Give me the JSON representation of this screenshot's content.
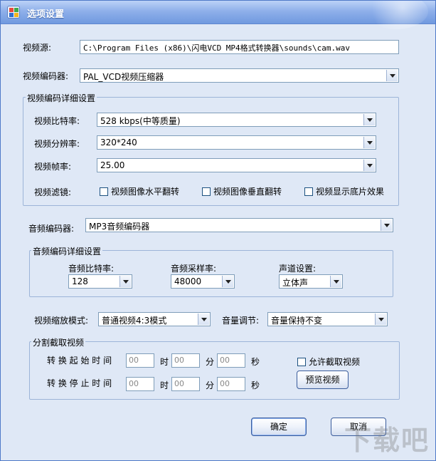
{
  "window": {
    "title": "选项设置"
  },
  "source": {
    "label": "视频源:",
    "value": "C:\\Program Files (x86)\\闪电VCD MP4格式转换器\\sounds\\cam.wav"
  },
  "video_encoder": {
    "label": "视频编码器:",
    "value": "PAL_VCD视频压缩器"
  },
  "video_detail": {
    "title": "视频编码详细设置",
    "bitrate": {
      "label": "视频比特率:",
      "value": "528 kbps(中等质量)"
    },
    "resolution": {
      "label": "视频分辨率:",
      "value": "320*240"
    },
    "framerate": {
      "label": "视频帧率:",
      "value": "25.00"
    },
    "filter": {
      "label": "视频滤镜:",
      "options": [
        "视频图像水平翻转",
        "视频图像垂直翻转",
        "视频显示底片效果"
      ]
    }
  },
  "audio_encoder": {
    "label": "音频编码器:",
    "value": "MP3音频编码器"
  },
  "audio_detail": {
    "title": "音频编码详细设置",
    "bitrate": {
      "label": "音频比特率:",
      "value": "128"
    },
    "samplerate": {
      "label": "音频采样率:",
      "value": "48000"
    },
    "channel": {
      "label": "声道设置:",
      "value": "立体声"
    }
  },
  "scale_mode": {
    "label": "视频缩放模式:",
    "value": "普通视频4:3模式"
  },
  "volume": {
    "label": "音量调节:",
    "value": "音量保持不变"
  },
  "split": {
    "title": "分割截取视频",
    "start_label": "转 换 起 始 时 间",
    "end_label": "转 换 停 止 时 间",
    "placeholder": "00",
    "hour": "时",
    "minute": "分",
    "second": "秒",
    "allow_label": "允许截取视频",
    "preview_label": "预览视频"
  },
  "buttons": {
    "ok": "确定",
    "cancel": "取消"
  },
  "watermark": "下载吧"
}
